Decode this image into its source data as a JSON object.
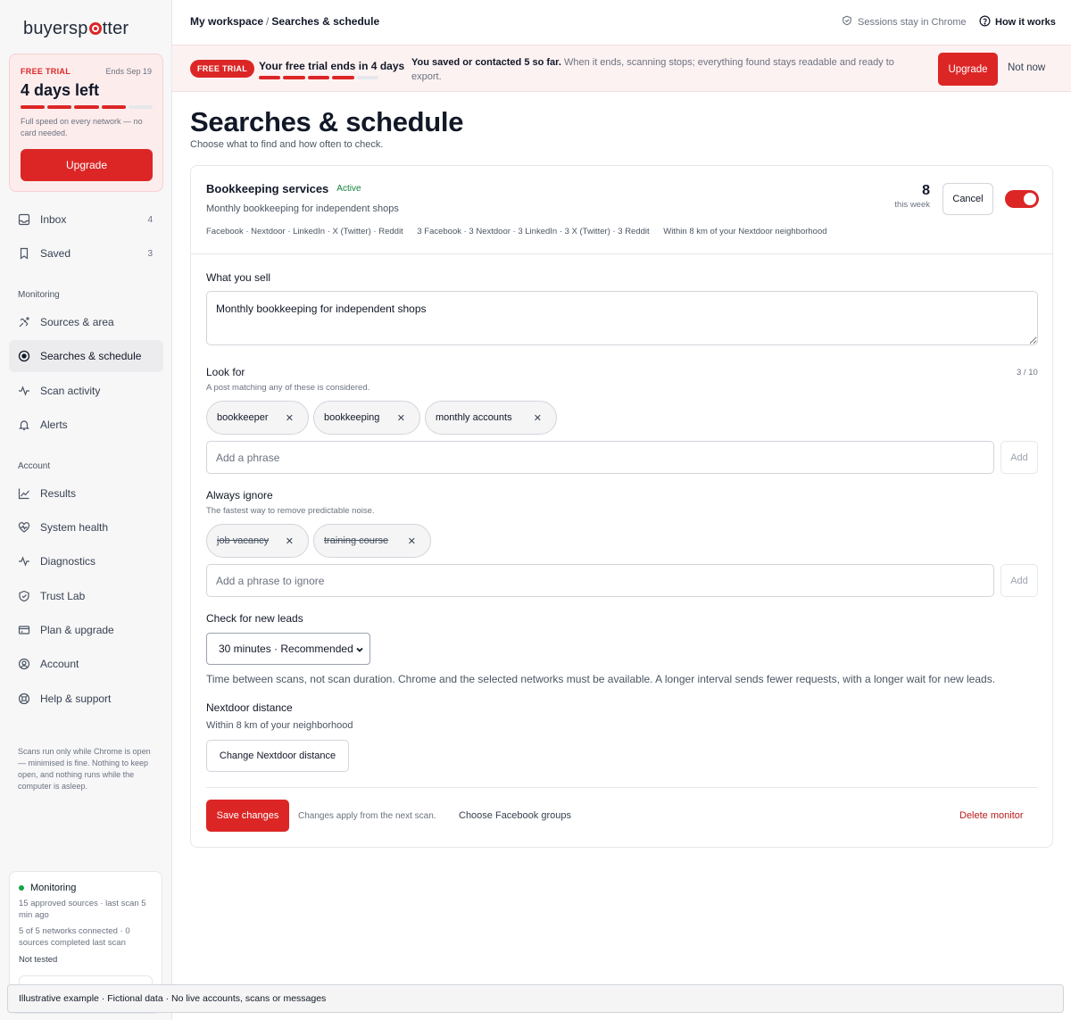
{
  "brand": {
    "name_start": "buyersp",
    "name_end": "tter"
  },
  "trial": {
    "tag": "FREE TRIAL",
    "ends": "Ends Sep 19",
    "days_left": "4 days left",
    "progress_segments_filled": 4,
    "progress_segments_total": 5,
    "note": "Full speed on every network — no card needed.",
    "upgrade_label": "Upgrade"
  },
  "sidebar": {
    "top_items": [
      {
        "label": "Inbox",
        "count": "4",
        "icon": "inbox-icon"
      },
      {
        "label": "Saved",
        "count": "3",
        "icon": "bookmark-icon"
      }
    ],
    "monitoring_label": "Monitoring",
    "monitoring_items": [
      {
        "label": "Sources & area",
        "icon": "satellite-icon"
      },
      {
        "label": "Searches & schedule",
        "icon": "target-icon",
        "active": true
      },
      {
        "label": "Scan activity",
        "icon": "pulse-icon"
      },
      {
        "label": "Alerts",
        "icon": "bell-icon"
      }
    ],
    "account_label": "Account",
    "account_items": [
      {
        "label": "Results",
        "icon": "chart-icon"
      },
      {
        "label": "System health",
        "icon": "heart-pulse-icon"
      },
      {
        "label": "Diagnostics",
        "icon": "activity-icon"
      },
      {
        "label": "Trust Lab",
        "icon": "shield-icon"
      },
      {
        "label": "Plan & upgrade",
        "icon": "card-icon"
      },
      {
        "label": "Account",
        "icon": "user-circle-icon"
      },
      {
        "label": "Help & support",
        "icon": "lifebuoy-icon"
      }
    ],
    "note": "Scans run only while Chrome is open — minimised is fine. Nothing to keep open, and nothing runs while the computer is asleep.",
    "monitor_card": {
      "title": "Monitoring",
      "line1": "15 approved sources · last scan 5 min ago",
      "line2": "5 of 5 networks connected · 0 sources completed last scan",
      "line3": "Not tested"
    }
  },
  "header": {
    "breadcrumb_root": "My workspace",
    "breadcrumb_sep": "/",
    "breadcrumb_current": "Searches & schedule",
    "sessions": "Sessions stay in Chrome",
    "how_it_works": "How it works"
  },
  "banner": {
    "pill": "FREE TRIAL",
    "ends_text": "Your free trial ends in 4 days",
    "progress_segments_filled": 4,
    "progress_segments_total": 5,
    "msg_bold": "You saved or contacted 5 so far.",
    "msg_rest": " When it ends, scanning stops; everything found stays readable and ready to export.",
    "upgrade_label": "Upgrade",
    "not_now_label": "Not now"
  },
  "page": {
    "title": "Searches & schedule",
    "subtitle": "Choose what to find and how often to check."
  },
  "monitor": {
    "name": "Bookkeeping services",
    "status": "Active",
    "description": "Monthly bookkeeping for independent shops",
    "networks": "Facebook · Nextdoor · LinkedIn · X (Twitter) · Reddit",
    "network_counts": "3 Facebook · 3 Nextdoor · 3 LinkedIn · 3 X (Twitter) · 3 Reddit",
    "area": "Within 8 km of your Nextdoor neighborhood",
    "count": "8",
    "count_label": "this week",
    "cancel_label": "Cancel",
    "enabled": true
  },
  "form": {
    "sell_label": "What you sell",
    "sell_value": "Monthly bookkeeping for independent shops",
    "look_for_label": "Look for",
    "look_for_hint": "A post matching any of these is considered.",
    "look_for_counter": "3 / 10",
    "look_for_chips": [
      "bookkeeper",
      "bookkeeping",
      "monthly accounts"
    ],
    "add_phrase_placeholder": "Add a phrase",
    "add_label": "Add",
    "ignore_label": "Always ignore",
    "ignore_hint": "The fastest way to remove predictable noise.",
    "ignore_chips": [
      "job vacancy",
      "training course"
    ],
    "add_ignore_placeholder": "Add a phrase to ignore",
    "add_ignore_label": "Add",
    "check_label": "Check for new leads",
    "check_value": "30 minutes · Recommended",
    "check_help": "Time between scans, not scan duration. Chrome and the selected networks must be available. A longer interval sends fewer requests, with a longer wait for new leads.",
    "distance_label": "Nextdoor distance",
    "distance_value": "Within 8 km of your neighborhood",
    "change_distance_label": "Change Nextdoor distance",
    "save_label": "Save changes",
    "apply_note": "Changes apply from the next scan.",
    "facebook_groups_label": "Choose Facebook groups",
    "delete_label": "Delete monitor"
  },
  "footer": {
    "text": "Illustrative example · Fictional data · No live accounts, scans or messages"
  },
  "colors": {
    "accent": "#dc2626",
    "active_green": "#15803d",
    "sidebar_bg": "#f7f7f8"
  }
}
